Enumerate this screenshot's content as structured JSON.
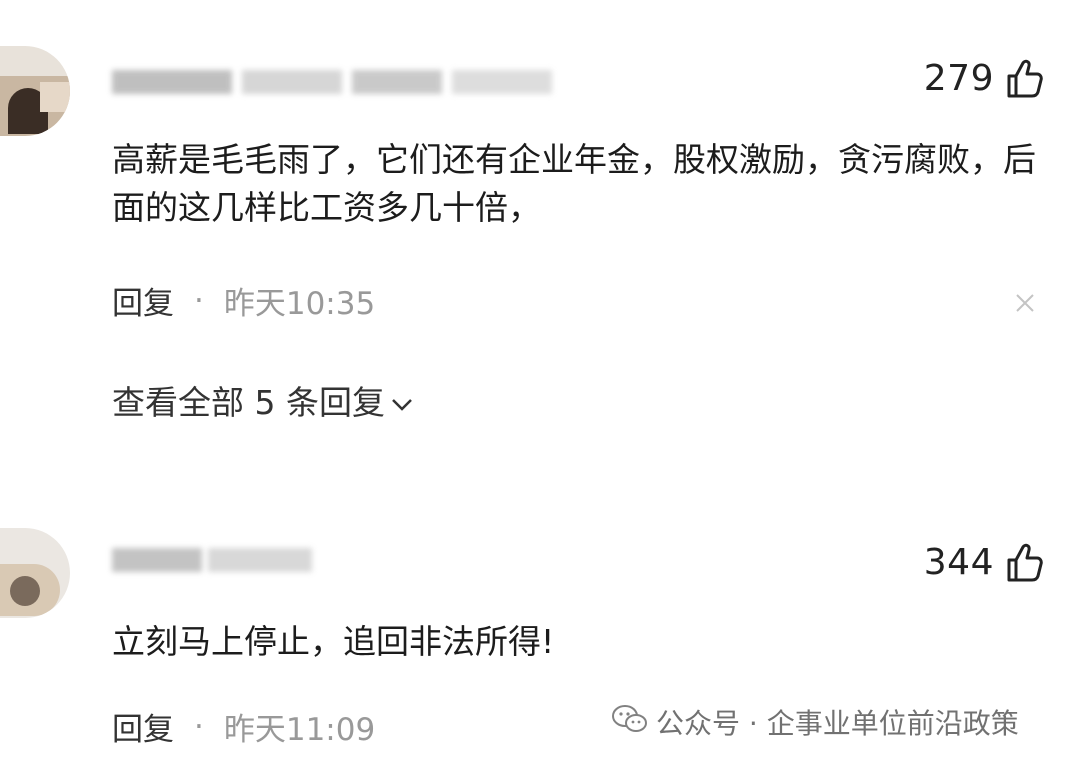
{
  "comments": [
    {
      "likes": "279",
      "text": "高薪是毛毛雨了，它们还有企业年金，股权激励，贪污腐败，后面的这几样比工资多几十倍，",
      "reply_label": "回复",
      "separator": "·",
      "time": "昨天10:35",
      "view_replies": "查看全部 5 条回复"
    },
    {
      "likes": "344",
      "text": "立刻马上停止，追回非法所得!",
      "reply_label": "回复",
      "separator": "·",
      "time": "昨天11:09"
    }
  ],
  "watermark": {
    "text": "公众号 · 企事业单位前沿政策"
  },
  "icons": {
    "like": "thumbs-up-icon",
    "close": "close-icon",
    "expand": "chevron-down-icon",
    "watermark": "wechat-icon"
  },
  "colors": {
    "primary_text": "#1c1c1c",
    "secondary_text": "#999999",
    "background": "#ffffff"
  }
}
